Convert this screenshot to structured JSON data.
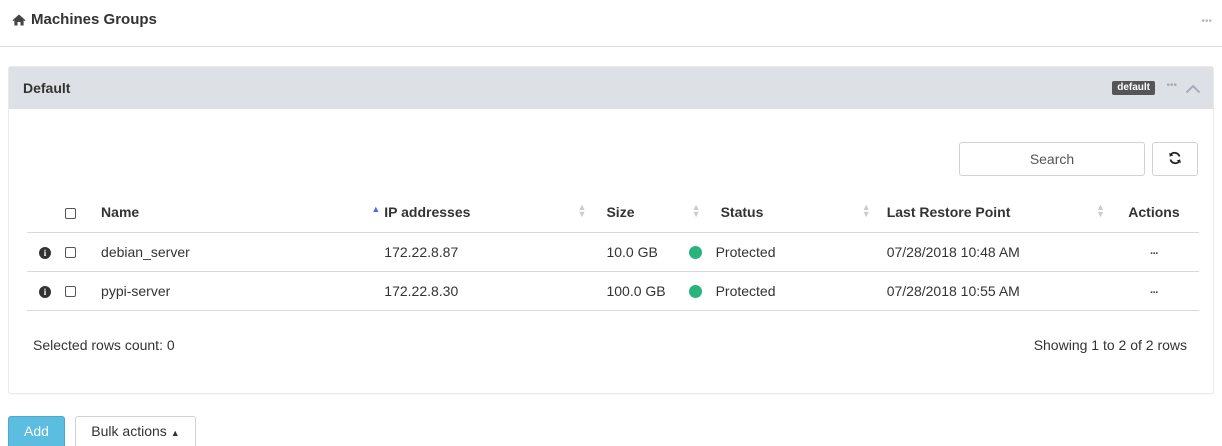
{
  "header": {
    "title": "Machines Groups",
    "home_icon": "home-icon",
    "menu_icon": "more-horizontal-icon"
  },
  "group": {
    "title": "Default",
    "badge": "default",
    "menu_icon": "more-horizontal-icon",
    "collapse_icon": "chevron-up-icon"
  },
  "toolbar": {
    "search_placeholder": "Search",
    "refresh_icon": "refresh-icon"
  },
  "table": {
    "columns": {
      "name": "Name",
      "ip": "IP addresses",
      "size": "Size",
      "status": "Status",
      "last_restore_point": "Last Restore Point",
      "actions": "Actions"
    },
    "sorted_column": "name",
    "sort_direction": "ascending",
    "rows": [
      {
        "name": "debian_server",
        "ip": "172.22.8.87",
        "size": "10.0 GB",
        "status": "Protected",
        "last_restore_point": "07/28/2018 10:48 AM",
        "actions": "···"
      },
      {
        "name": "pypi-server",
        "ip": "172.22.8.30",
        "size": "100.0 GB",
        "status": "Protected",
        "last_restore_point": "07/28/2018 10:55 AM",
        "actions": "···"
      }
    ]
  },
  "footer": {
    "selected_count": "Selected rows count: 0",
    "showing": "Showing 1 to 2 of 2 rows"
  },
  "actions": {
    "add_label": "Add",
    "bulk_label": "Bulk actions"
  },
  "colors": {
    "status_protected": "#27b57b",
    "add_button": "#5bbde0",
    "panel_header": "#dde0e4",
    "sort_active": "#4a6fd6"
  }
}
